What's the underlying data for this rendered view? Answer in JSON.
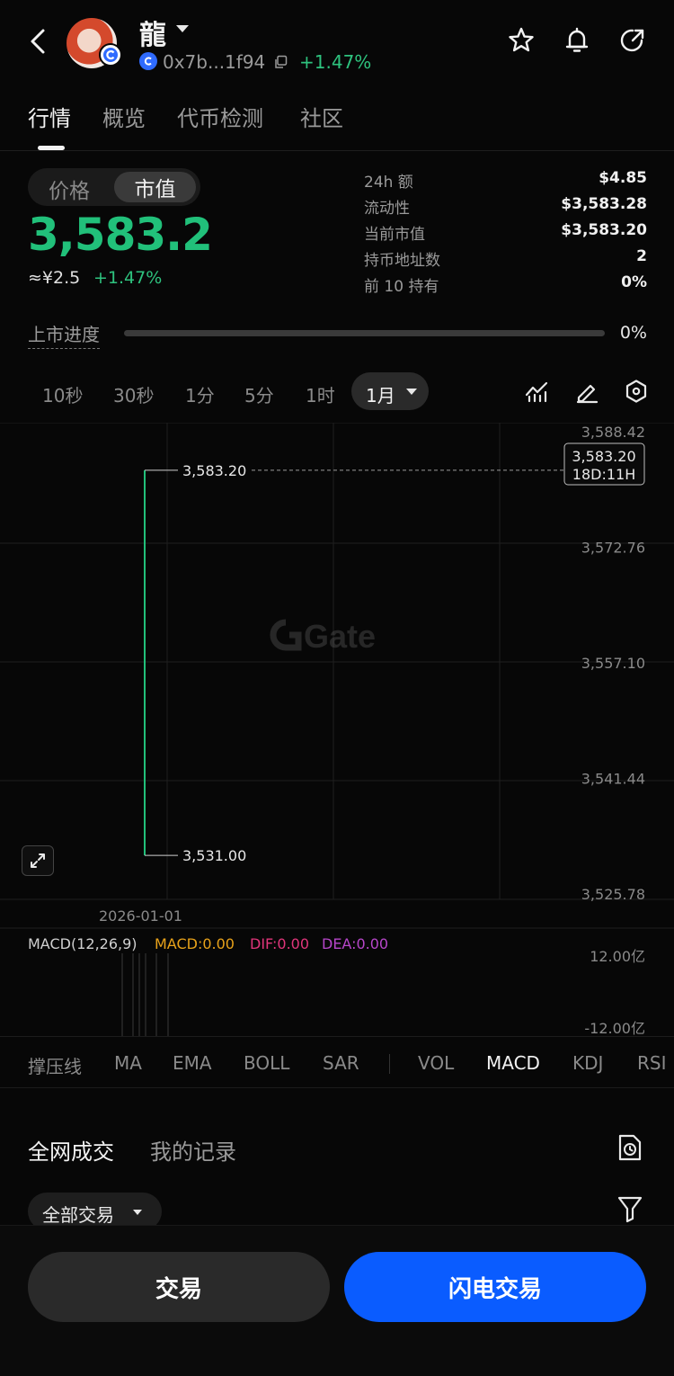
{
  "header": {
    "token_name": "龍",
    "address": "0x7b...1f94",
    "change_pct": "+1.47%",
    "icons": [
      "back-icon",
      "star-icon",
      "bell-icon",
      "share-icon",
      "copy-icon"
    ]
  },
  "tabs": [
    {
      "label": "行情",
      "active": true
    },
    {
      "label": "概览",
      "active": false
    },
    {
      "label": "代币检测",
      "active": false
    },
    {
      "label": "社区",
      "active": false
    }
  ],
  "price_panel": {
    "toggle": {
      "option_price": "价格",
      "option_mcap": "市值",
      "selected": "市值"
    },
    "value": "3,583.2",
    "cny": "≈¥2.5",
    "change": "+1.47%"
  },
  "stats": [
    {
      "label": "24h  额",
      "value": "$4.85"
    },
    {
      "label": "流动性",
      "value": "$3,583.28"
    },
    {
      "label": "当前市值",
      "value": "$3,583.20"
    },
    {
      "label": "持币地址数",
      "value": "2"
    },
    {
      "label": "前 10 持有",
      "value": "0%"
    }
  ],
  "progress": {
    "label": "上市进度",
    "value": "0%",
    "fraction": 0
  },
  "intervals": {
    "items": [
      "10秒",
      "30秒",
      "1分",
      "5分",
      "1时"
    ],
    "selected": "1月"
  },
  "chart": {
    "watermark": "Gate",
    "y_ticks": [
      "3,588.42",
      "3,572.76",
      "3,557.10",
      "3,541.44",
      "3,525.78"
    ],
    "high_label": "3,583.20",
    "low_label": "3,531.00",
    "current_price": "3,583.20",
    "countdown": "18D:11H",
    "x_label": "2026-01-01",
    "colors": {
      "up": "#21c07a",
      "grid": "#1f1f1f"
    }
  },
  "chart_data": {
    "type": "line",
    "x": [
      "2026-01-01"
    ],
    "high": 3583.2,
    "low": 3531.0,
    "close": 3583.2,
    "ylim": [
      3525.78,
      3588.42
    ],
    "yticks": [
      3588.42,
      3572.76,
      3557.1,
      3541.44,
      3525.78
    ]
  },
  "macd": {
    "title": "MACD(12,26,9)",
    "macd": "MACD:0.00",
    "dif": "DIF:0.00",
    "dea": "DEA:0.00",
    "top": "12.00亿",
    "bottom": "-12.00亿",
    "colors": {
      "macd": "#e8a21a",
      "dif": "#e0357a",
      "dea": "#b646c9"
    }
  },
  "indicators": {
    "main": [
      "撑压线",
      "MA",
      "EMA",
      "BOLL",
      "SAR"
    ],
    "sub": [
      "VOL",
      "MACD",
      "KDJ",
      "RSI"
    ],
    "active": "MACD"
  },
  "trades": {
    "tab_all": "全网成交",
    "tab_mine": "我的记录",
    "filter": "全部交易"
  },
  "actions": {
    "trade": "交易",
    "flash_trade": "闪电交易"
  }
}
